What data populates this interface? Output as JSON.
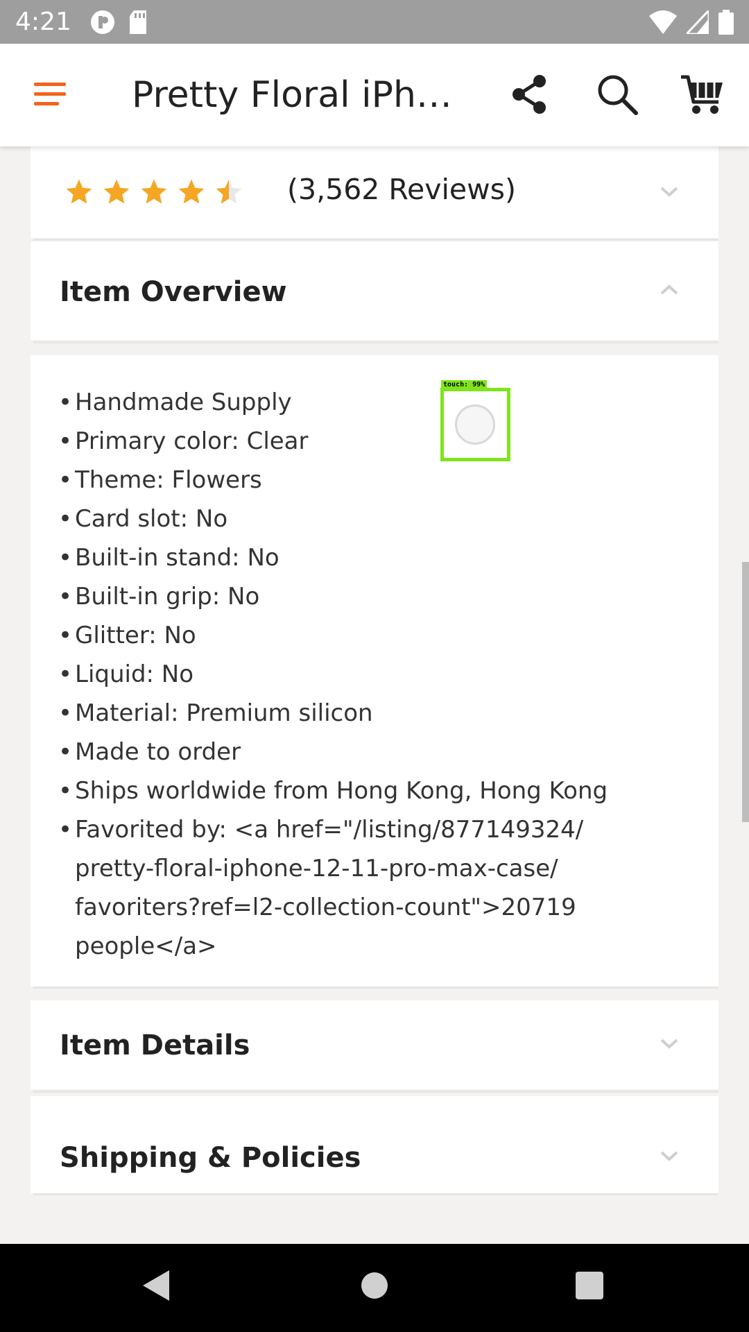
{
  "status_bar": {
    "time": "4:21",
    "left_icons": [
      "vpn-key-icon",
      "sd-card-icon"
    ],
    "right_icons": [
      "wifi-icon",
      "cell-signal-icon",
      "battery-icon"
    ]
  },
  "app_bar": {
    "title": "Pretty Floral iPho...",
    "icons": [
      "menu-icon",
      "share-icon",
      "search-icon",
      "cart-icon"
    ]
  },
  "reviews": {
    "rating": 4.5,
    "rating_max": 5,
    "label": "(3,562 Reviews)"
  },
  "item_overview": {
    "title": "Item Overview",
    "items": [
      "Handmade Supply",
      "Primary color: Clear",
      "Theme: Flowers",
      "Card slot: No",
      "Built-in stand: No",
      "Built-in grip: No",
      "Glitter: No",
      "Liquid: No",
      "Material: Premium silicon",
      "Made to order",
      "Ships worldwide from Hong Kong, Hong Kong",
      "Favorited by: <a href=\"/listing/877149324/ pretty-floral-iphone-12-11-pro-max-case/ favoriters?ref=l2-collection-count\">20719 people</a>"
    ]
  },
  "item_details": {
    "title": "Item Details"
  },
  "shipping": {
    "title": "Shipping & Policies"
  },
  "touch_indicator": {
    "label": "touch: 99%"
  },
  "colors": {
    "accent": "#f1641e",
    "star": "#f5a623",
    "touch_box": "#7fe51a",
    "status_bar": "#9e9e9e"
  }
}
